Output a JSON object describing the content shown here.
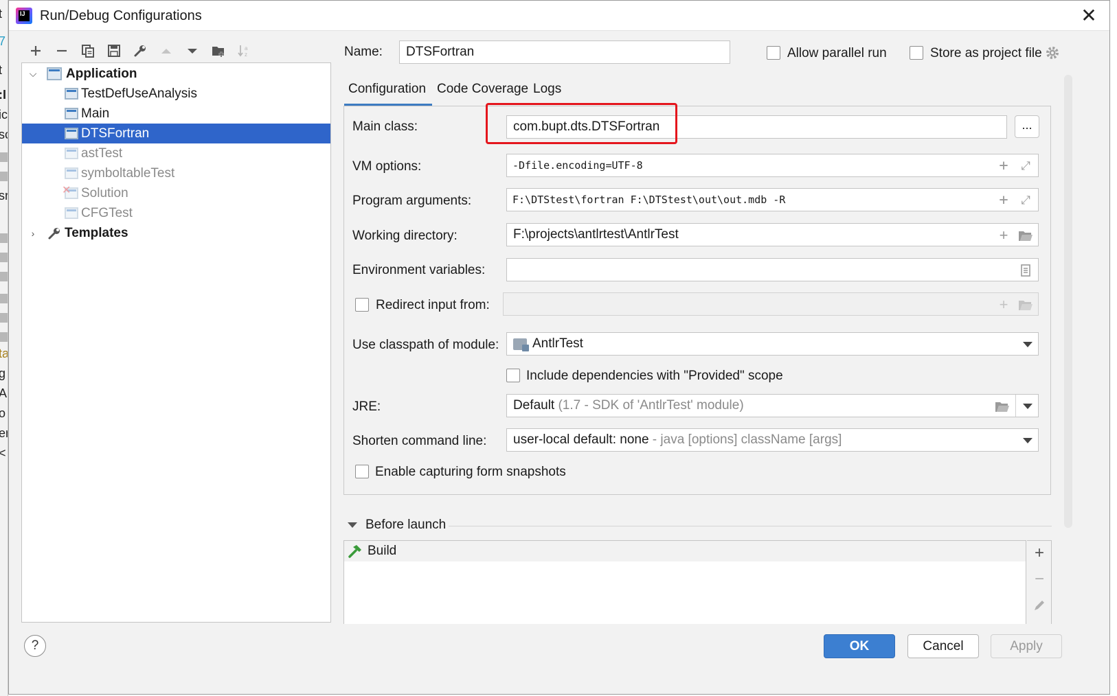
{
  "window": {
    "title": "Run/Debug Configurations",
    "close_glyph": "✕"
  },
  "background_ide": {
    "fragments": [
      "t",
      "7",
      "t",
      ":I",
      "ic",
      "sc",
      "sr",
      "ta",
      "g",
      "A",
      "o",
      "er",
      "<"
    ]
  },
  "toolbar": {
    "items": [
      {
        "name": "add-config-button",
        "icon": "plus-icon",
        "glyph": "+",
        "enabled": true
      },
      {
        "name": "remove-config-button",
        "icon": "minus-icon",
        "glyph": "−",
        "enabled": true
      },
      {
        "name": "copy-config-button",
        "icon": "copy-icon",
        "enabled": true
      },
      {
        "name": "save-config-button",
        "icon": "save-icon",
        "enabled": true
      },
      {
        "name": "edit-defaults-button",
        "icon": "wrench-icon",
        "enabled": true
      },
      {
        "name": "move-up-button",
        "icon": "arrow-up-icon",
        "enabled": false
      },
      {
        "name": "move-down-button",
        "icon": "arrow-down-icon",
        "enabled": true
      },
      {
        "name": "new-folder-button",
        "icon": "folder-add-icon",
        "enabled": true
      },
      {
        "name": "sort-button",
        "icon": "sort-az-icon",
        "enabled": false
      }
    ]
  },
  "tree": {
    "application": {
      "label": "Application",
      "expanded": true
    },
    "items": [
      {
        "label": "TestDefUseAnalysis",
        "dim": false,
        "error": false,
        "selected": false
      },
      {
        "label": "Main",
        "dim": false,
        "error": false,
        "selected": false
      },
      {
        "label": "DTSFortran",
        "dim": false,
        "error": false,
        "selected": true
      },
      {
        "label": "astTest",
        "dim": true,
        "error": false,
        "selected": false
      },
      {
        "label": "symboltableTest",
        "dim": true,
        "error": false,
        "selected": false
      },
      {
        "label": "Solution",
        "dim": true,
        "error": true,
        "selected": false
      },
      {
        "label": "CFGTest",
        "dim": true,
        "error": false,
        "selected": false
      }
    ],
    "templates": {
      "label": "Templates",
      "expanded": false
    }
  },
  "header": {
    "name_label": "Name:",
    "name_value": "DTSFortran",
    "allow_parallel_label": "Allow parallel run",
    "allow_parallel_checked": false,
    "store_project_label": "Store as project file",
    "store_project_checked": false
  },
  "tabs": [
    {
      "label": "Configuration",
      "active": true
    },
    {
      "label": "Code Coverage",
      "active": false
    },
    {
      "label": "Logs",
      "active": false
    }
  ],
  "form": {
    "main_class_label": "Main class:",
    "main_class_value": "com.bupt.dts.DTSFortran",
    "browse_label": "...",
    "vm_options_label": "VM options:",
    "vm_options_value": "-Dfile.encoding=UTF-8",
    "program_args_label": "Program arguments:",
    "program_args_value": "F:\\DTStest\\fortran F:\\DTStest\\out\\out.mdb -R",
    "working_dir_label": "Working directory:",
    "working_dir_value": "F:\\projects\\antlrtest\\AntlrTest",
    "env_vars_label": "Environment variables:",
    "env_vars_value": "",
    "redirect_label": "Redirect input from:",
    "redirect_checked": false,
    "classpath_label": "Use classpath of module:",
    "classpath_value": "AntlrTest",
    "include_deps_label": "Include dependencies with \"Provided\" scope",
    "include_deps_checked": false,
    "jre_label": "JRE:",
    "jre_value": "Default",
    "jre_hint": "(1.7 - SDK of 'AntlrTest' module)",
    "shorten_label": "Shorten command line:",
    "shorten_value": "user-local default: none",
    "shorten_hint": "- java [options] className [args]",
    "snapshots_label": "Enable capturing form snapshots",
    "snapshots_checked": false
  },
  "before_launch": {
    "label": "Before launch",
    "items": [
      {
        "label": "Build",
        "icon": "hammer-icon"
      }
    ]
  },
  "footer": {
    "help_label": "?",
    "ok_label": "OK",
    "cancel_label": "Cancel",
    "apply_label": "Apply"
  },
  "colors": {
    "accent": "#3c7fd1",
    "selection": "#2f65ca",
    "highlight_box": "#e4161d",
    "error_x": "#e0282e"
  }
}
